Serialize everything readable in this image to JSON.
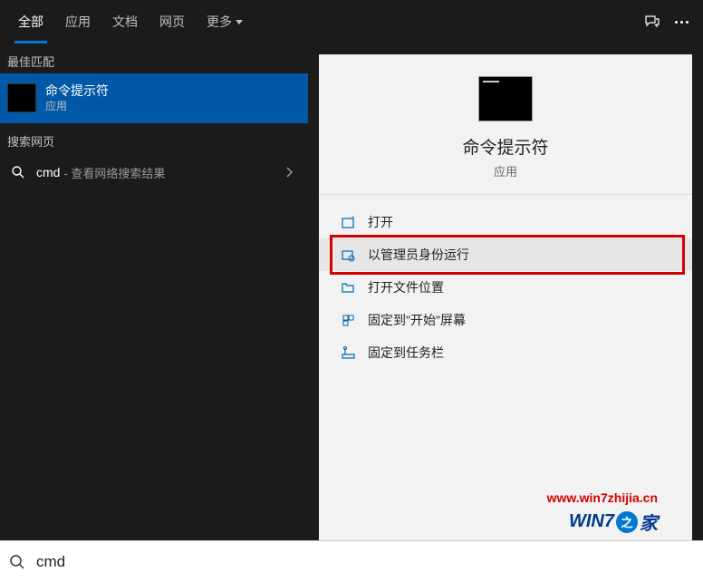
{
  "header": {
    "tabs": [
      {
        "label": "全部",
        "active": true
      },
      {
        "label": "应用",
        "active": false
      },
      {
        "label": "文档",
        "active": false
      },
      {
        "label": "网页",
        "active": false
      }
    ],
    "more_label": "更多"
  },
  "left": {
    "best_match_header": "最佳匹配",
    "best_match": {
      "title": "命令提示符",
      "subtitle": "应用"
    },
    "web_header": "搜索网页",
    "web_item": {
      "query": "cmd",
      "hint": "- 查看网络搜索结果"
    }
  },
  "preview": {
    "title": "命令提示符",
    "subtitle": "应用",
    "actions": [
      {
        "icon": "open-icon",
        "label": "打开",
        "highlighted": false
      },
      {
        "icon": "admin-icon",
        "label": "以管理员身份运行",
        "highlighted": true
      },
      {
        "icon": "folder-icon",
        "label": "打开文件位置",
        "highlighted": false
      },
      {
        "icon": "pin-start-icon",
        "label": "固定到\"开始\"屏幕",
        "highlighted": false
      },
      {
        "icon": "pin-taskbar-icon",
        "label": "固定到任务栏",
        "highlighted": false
      }
    ]
  },
  "search": {
    "value": "cmd"
  },
  "watermark": {
    "url": "www.win7zhijia.cn",
    "logo_part1": "WIN",
    "logo_part2": "7",
    "logo_badge": "之",
    "logo_part3": "家"
  }
}
